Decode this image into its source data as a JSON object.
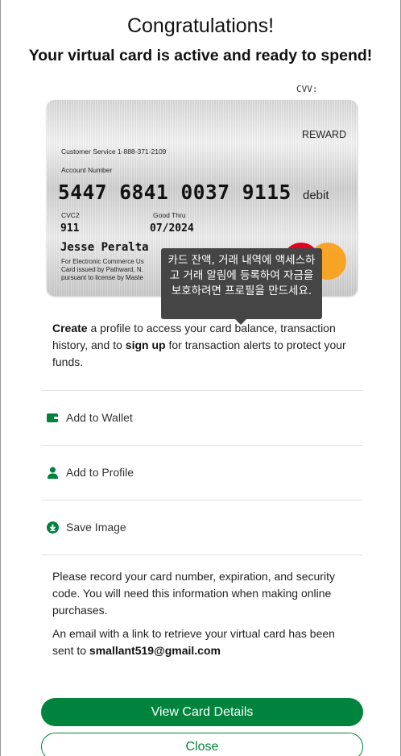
{
  "header": {
    "title": "Congratulations!",
    "subtitle": "Your virtual card is active and ready to spend!"
  },
  "cvv_label": "CVV:",
  "card": {
    "reward": "REWARD",
    "customer_service": "Customer Service 1-888-371-2109",
    "account_number_label": "Account Number",
    "account_number": "5447 6841 0037 9115",
    "type": "debit",
    "cvc_label": "CVC2",
    "cvc": "911",
    "good_thru_label": "Good Thru",
    "good_thru": "07/2024",
    "holder_name": "Jesse Peralta",
    "fine_print_1": "For Electronic Commerce Us",
    "fine_print_2": "Card issued by Pathward, N.",
    "fine_print_3": "pursuant to license by Maste",
    "brand_colors": [
      "#e4001c",
      "#f9a01b"
    ]
  },
  "tooltip": {
    "text": "카드 잔액, 거래 내역에 액세스하고 거래 알림에 등록하여 자금을 보호하려면 프로필을 만드세요."
  },
  "intro": {
    "create": "Create",
    "part1": " a profile to access your card balance, transaction history, and to ",
    "sign_up": "sign up",
    "part2": " for transaction alerts to protect your funds."
  },
  "actions": [
    {
      "label": "Add to Wallet",
      "icon": "wallet-icon"
    },
    {
      "label": "Add to Profile",
      "icon": "person-icon"
    },
    {
      "label": "Save Image",
      "icon": "download-icon"
    }
  ],
  "notes": {
    "record": "Please record your card number, expiration, and security code. You will need this information when making online purchases.",
    "email_prefix": "An email with a link to retrieve your virtual card has been sent to ",
    "email": "smallant519@gmail.com"
  },
  "buttons": {
    "view_details": "View Card Details",
    "close": "Close"
  },
  "colors": {
    "accent": "#00843d",
    "tooltip_bg": "#454545"
  }
}
